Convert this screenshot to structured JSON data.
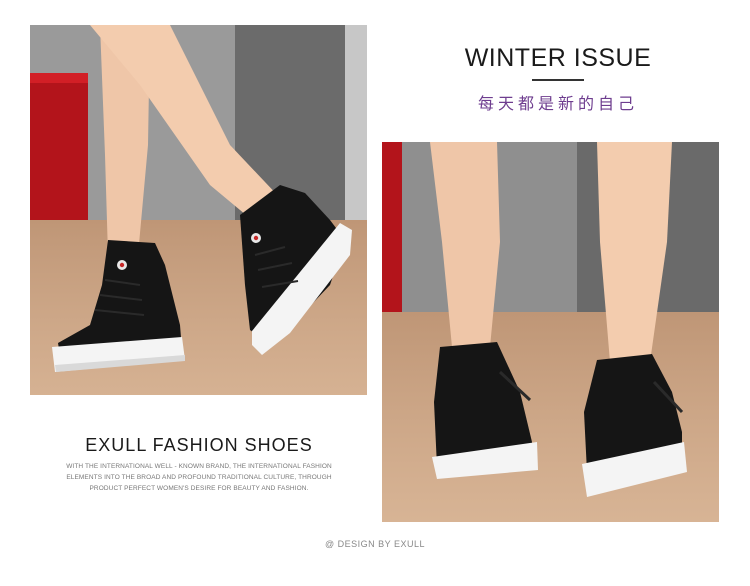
{
  "left_photo": {
    "alt": ""
  },
  "right_photo": {
    "alt": ""
  },
  "winter": {
    "title": "WINTER ISSUE",
    "subtitle": "每天都是新的自己"
  },
  "fashion": {
    "title": "EXULL  FASHION  SHOES",
    "lines": [
      "WITH THE INTERNATIONAL WELL - KNOWN BRAND, THE INTERNATIONAL FASHION",
      "ELEMENTS INTO THE BROAD AND PROFOUND TRADITIONAL CULTURE, THROUGH",
      "PRODUCT PERFECT WOMEN'S DESIRE FOR BEAUTY AND FASHION."
    ]
  },
  "footer": {
    "credit": "@ DESIGN BY EXULL"
  },
  "colors": {
    "accent_purple": "#6e3d8f",
    "red_prop": "#b3141b",
    "shoe_black": "#151515",
    "sole_white": "#f4f4f4",
    "floor": "#c9a07f"
  }
}
